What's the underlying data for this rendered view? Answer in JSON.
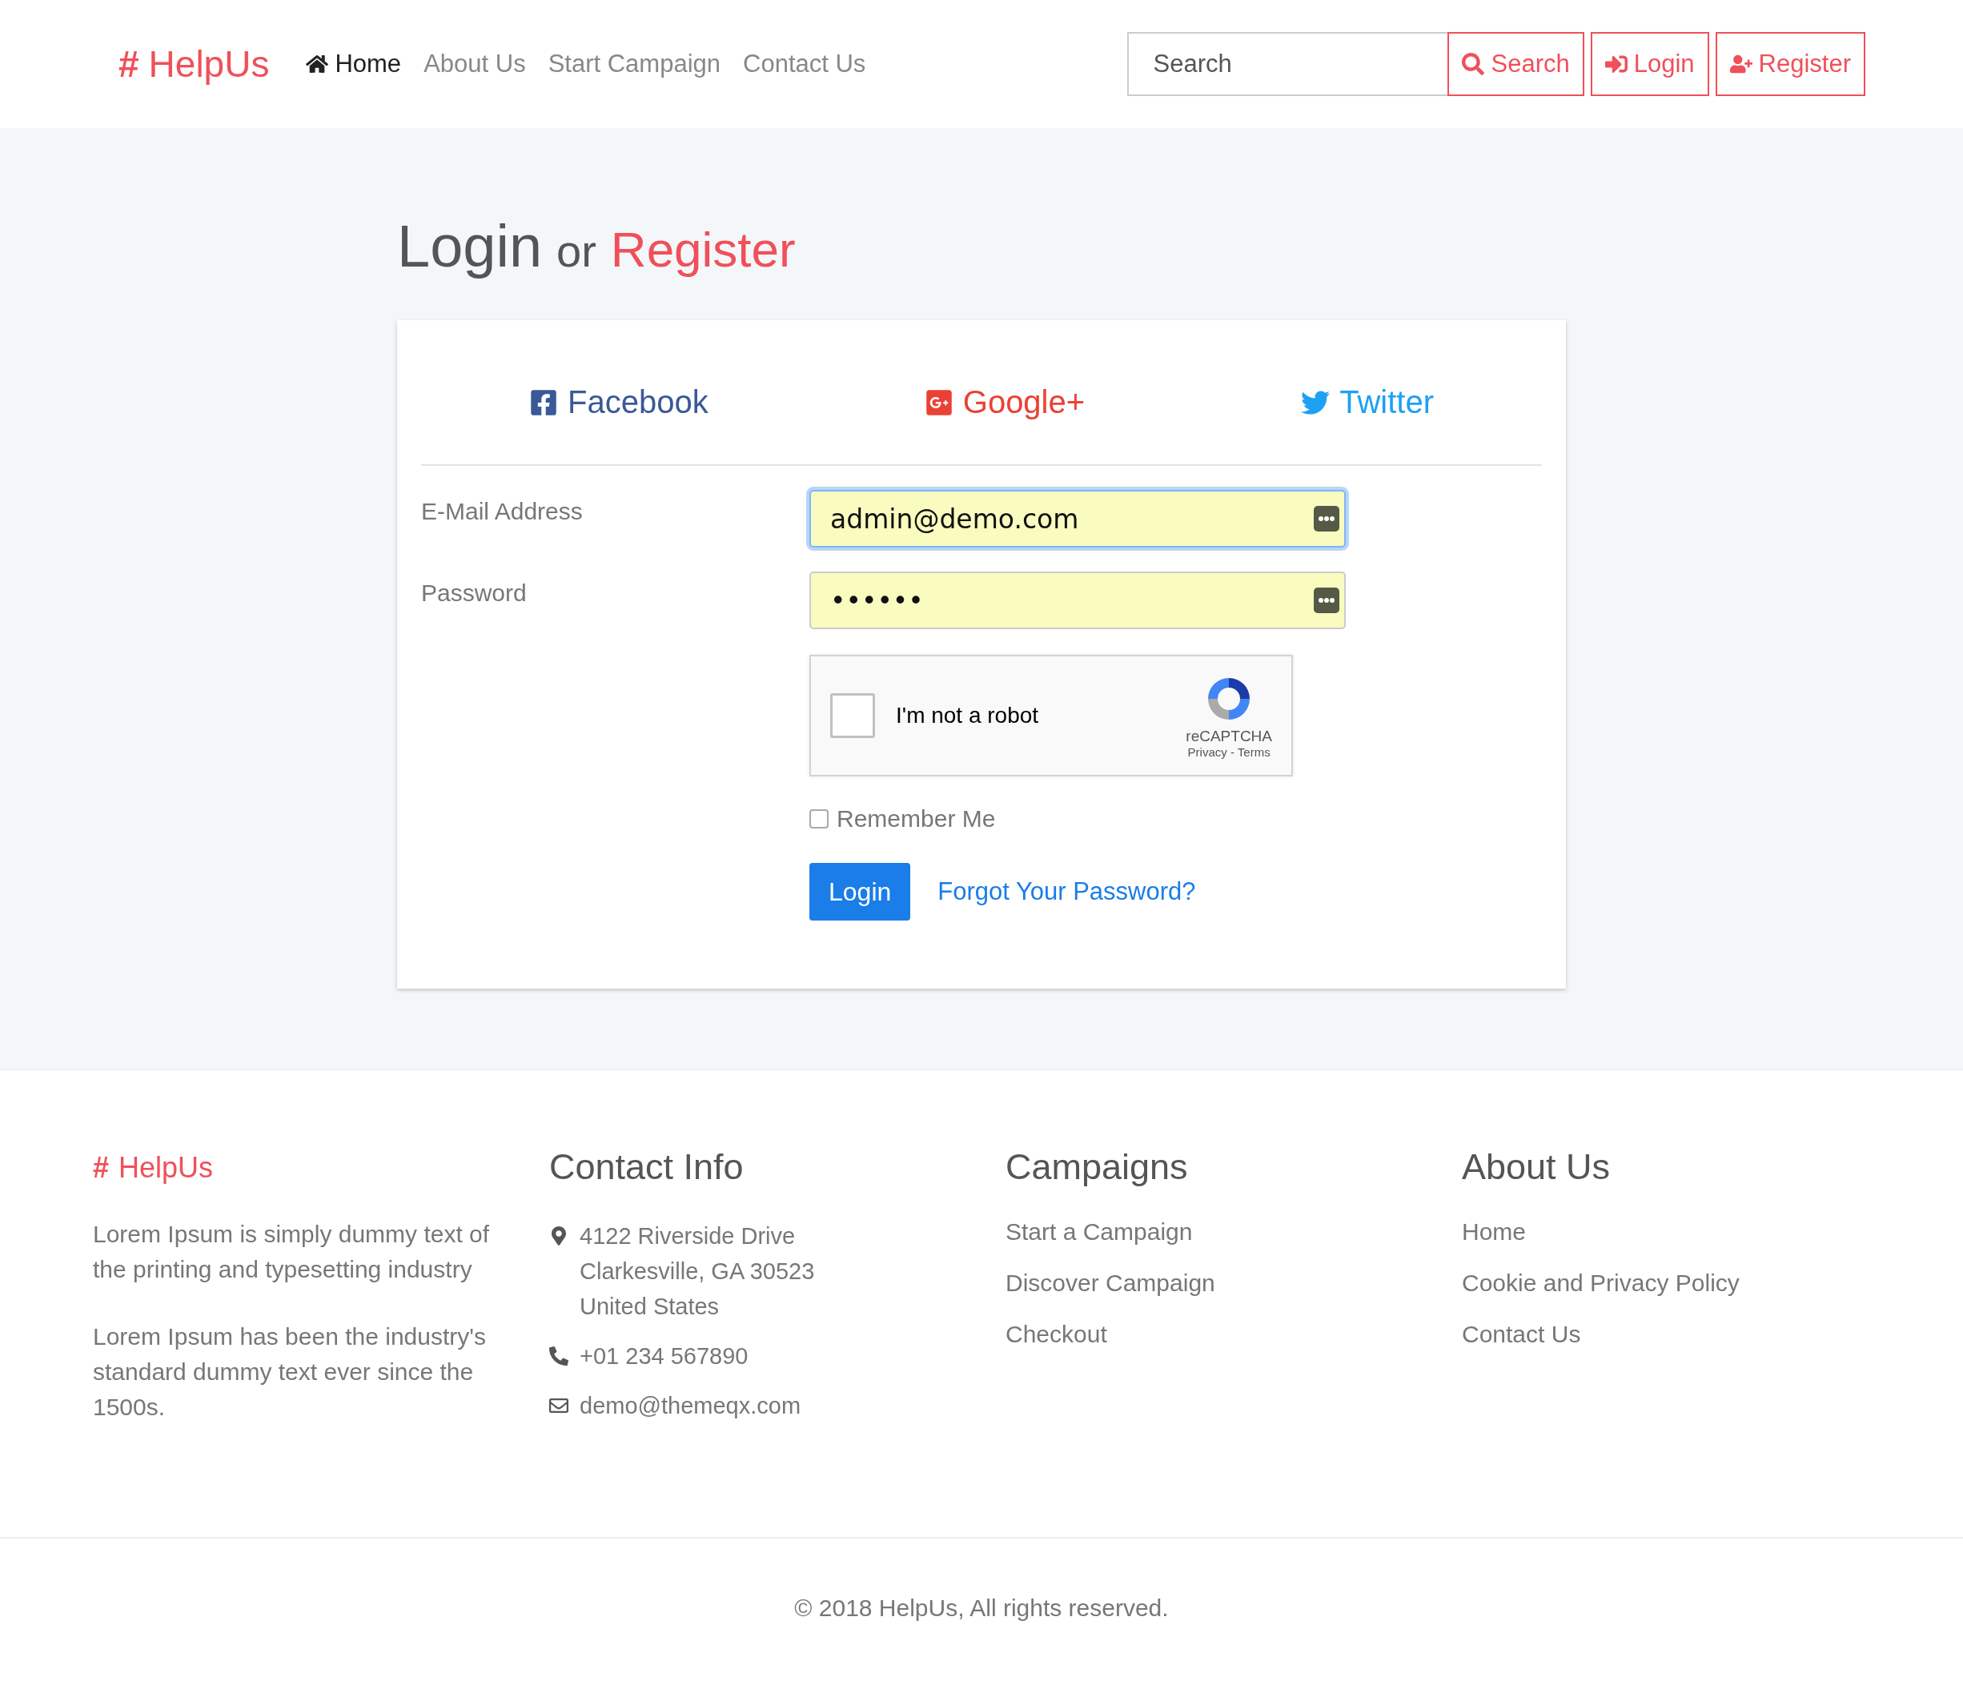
{
  "navbar": {
    "logo": {
      "hash": "#",
      "name": "HelpUs"
    },
    "links": [
      {
        "label": "Home",
        "selected": true
      },
      {
        "label": "About Us",
        "selected": false
      },
      {
        "label": "Start Campaign",
        "selected": false
      },
      {
        "label": "Contact Us",
        "selected": false
      }
    ],
    "search": {
      "placeholder": "Search"
    },
    "buttons": [
      {
        "kind": "search",
        "label": "Search"
      },
      {
        "kind": "login",
        "label": "Login"
      },
      {
        "kind": "register",
        "label": "Register"
      }
    ]
  },
  "page_title": {
    "main": "Login",
    "joiner": "or",
    "accent": "Register"
  },
  "social": [
    {
      "kind": "facebook",
      "label": "Facebook"
    },
    {
      "kind": "google",
      "label": "Google+"
    },
    {
      "kind": "twitter",
      "label": "Twitter"
    }
  ],
  "form": {
    "fields": [
      {
        "label": "E-Mail Address",
        "value": "admin@demo.com",
        "focused": true
      },
      {
        "label": "Password",
        "value": "••••••",
        "focused": false
      }
    ],
    "captcha": {
      "label": "I'm not a robot",
      "checked": false,
      "brand": "reCAPTCHA",
      "links": "Privacy - Terms"
    },
    "remember": {
      "label": "Remember Me",
      "checked": false
    },
    "submit": "Login",
    "forgot": "Forgot Your Password?"
  },
  "footer": {
    "brand": {
      "hash": "#",
      "name": "HelpUs"
    },
    "about_paragraphs": [
      "Lorem Ipsum is simply dummy text of the printing and typesetting industry",
      "Lorem Ipsum has been the industry's standard dummy text ever since the 1500s."
    ],
    "contact": {
      "title": "Contact Info",
      "items": [
        {
          "kind": "address",
          "lines": [
            "4122 Riverside Drive",
            "Clarkesville, GA 30523",
            "United States"
          ]
        },
        {
          "kind": "phone",
          "lines": [
            "+01 234 567890"
          ]
        },
        {
          "kind": "email",
          "lines": [
            "demo@themeqx.com"
          ]
        }
      ]
    },
    "campaigns": {
      "title": "Campaigns",
      "links": [
        "Start a Campaign",
        "Discover Campaign",
        "Checkout"
      ]
    },
    "about": {
      "title": "About Us",
      "links": [
        "Home",
        "Cookie and Privacy Policy",
        "Contact Us"
      ]
    },
    "copyright": "© 2018 HelpUs, All rights reserved."
  }
}
